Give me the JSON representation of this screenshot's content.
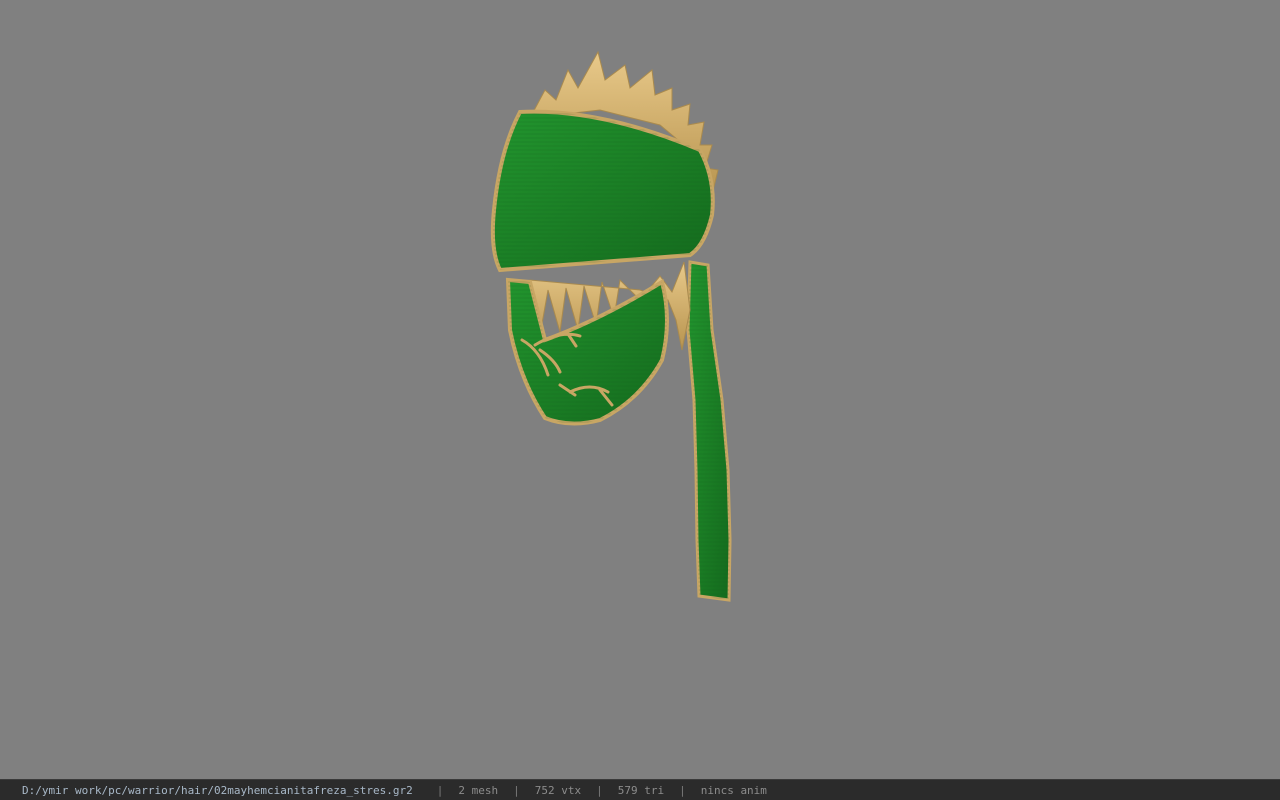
{
  "window": {
    "background_color": "#808080"
  },
  "viewport": {
    "model_name": "02mayhemcianitafreza_stres",
    "colors": {
      "cloth_green": "#1f8a2a",
      "cloth_dark": "#156b1e",
      "gold_trim": "#c8a664",
      "hair_blonde": "#d9b36a"
    }
  },
  "status_bar": {
    "file_path": "D:/ymir work/pc/warrior/hair/02mayhemcianitafreza_stres.gr2",
    "separator": "|",
    "mesh_count": "2 mesh",
    "vertex_count": "752 vtx",
    "triangle_count": "579 tri",
    "anim_status": "nincs anim"
  }
}
